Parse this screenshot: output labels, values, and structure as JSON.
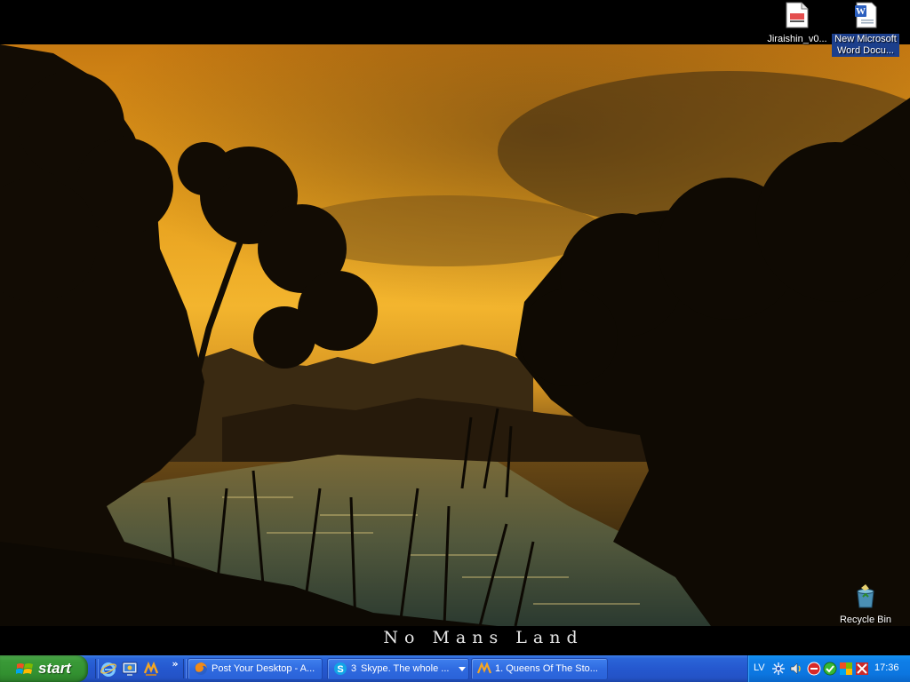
{
  "desktop": {
    "wallpaper_caption": "No Mans Land",
    "icons": [
      {
        "label": "Jiraishin_v0...",
        "icon": "document-file-icon"
      },
      {
        "label": "New Microsoft Word Docu...",
        "icon": "word-document-icon"
      },
      {
        "label": "Recycle Bin",
        "icon": "recycle-bin-icon"
      }
    ]
  },
  "taskbar": {
    "start_label": "start",
    "quick_launch": [
      "internet-explorer-icon",
      "show-desktop-icon",
      "winamp-icon"
    ],
    "chevron": "»",
    "tasks": [
      {
        "label": "Post Your Desktop - A...",
        "icon": "firefox-icon",
        "count": "",
        "dropdown": false
      },
      {
        "label": "Skype. The whole ...",
        "icon": "skype-icon",
        "count": "3",
        "dropdown": true
      },
      {
        "label": "1. Queens Of The Sto...",
        "icon": "winamp-icon",
        "count": "",
        "dropdown": false
      }
    ],
    "tray": {
      "language": "LV",
      "icons": [
        "network-icon",
        "audio-icon",
        "antivirus-icon",
        "connection-icon",
        "security-icon",
        "display-icon",
        "mail-icon"
      ],
      "clock": "17:36"
    }
  }
}
